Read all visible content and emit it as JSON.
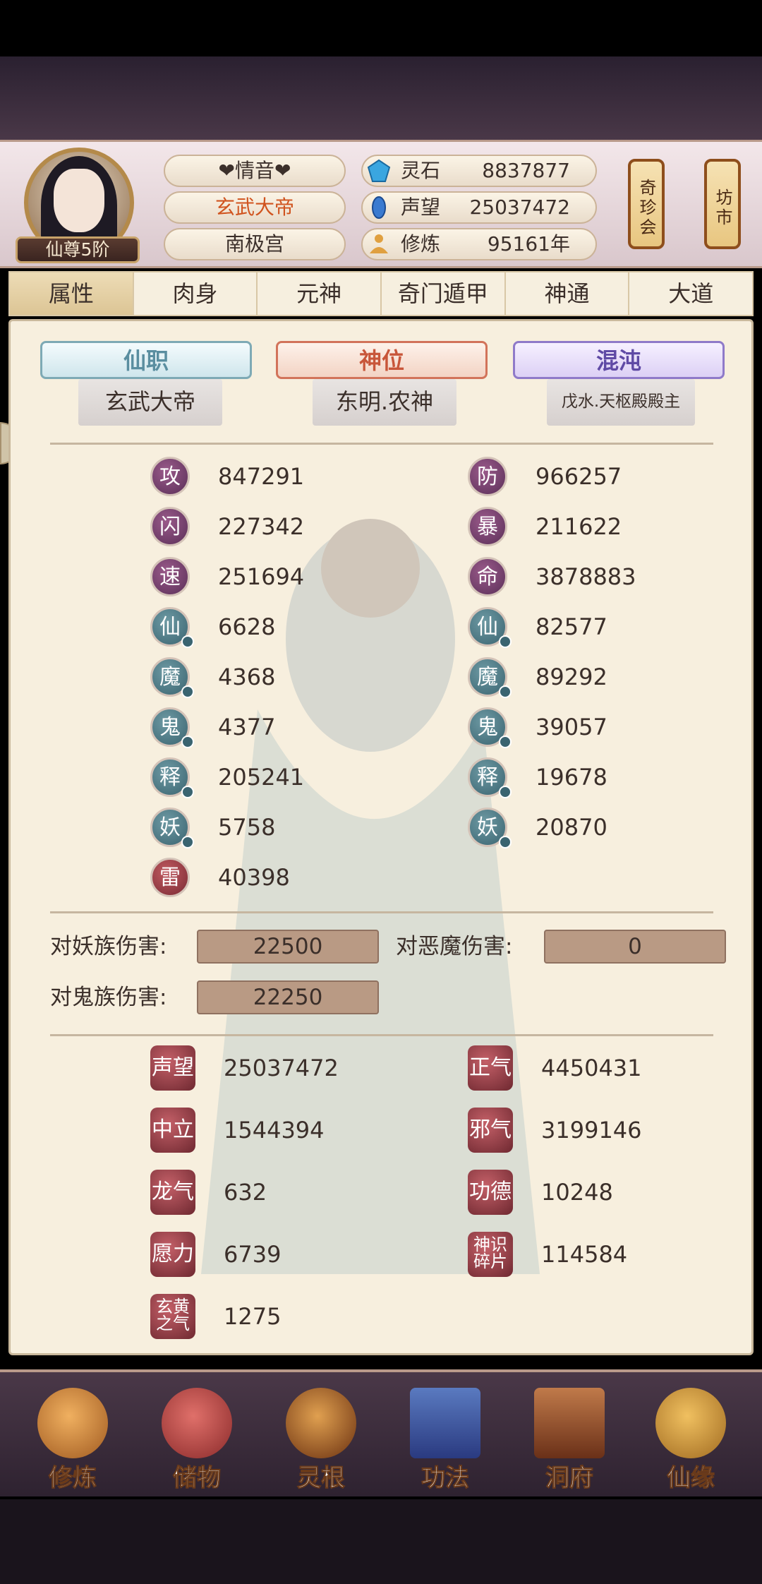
{
  "header": {
    "avatar_rank": "仙尊5阶",
    "name": "❤情音❤",
    "title": "玄武大帝",
    "palace": "南极宫",
    "resources": [
      {
        "icon": "spirit-stone-icon",
        "label": "灵石",
        "value": "8837877"
      },
      {
        "icon": "reputation-icon",
        "label": "声望",
        "value": "25037472"
      },
      {
        "icon": "meditate-icon",
        "label": "修炼",
        "value": "95161年"
      }
    ],
    "lanterns": [
      "奇珍会",
      "坊市"
    ]
  },
  "tabs": [
    "属性",
    "肉身",
    "元神",
    "奇门遁甲",
    "神通",
    "大道"
  ],
  "ranks": {
    "xianzhi": {
      "label": "仙职",
      "value": "玄武大帝"
    },
    "shenwei": {
      "label": "神位",
      "value": "东明.农神"
    },
    "hundun": {
      "label": "混沌",
      "value": "戊水.天枢殿殿主"
    }
  },
  "stats_left": [
    {
      "glyph": "攻",
      "value": "847291"
    },
    {
      "glyph": "闪",
      "value": "227342"
    },
    {
      "glyph": "速",
      "value": "251694"
    },
    {
      "glyph": "仙",
      "value": "6628"
    },
    {
      "glyph": "魔",
      "value": "4368"
    },
    {
      "glyph": "鬼",
      "value": "4377"
    },
    {
      "glyph": "释",
      "value": "205241"
    },
    {
      "glyph": "妖",
      "value": "5758"
    },
    {
      "glyph": "雷",
      "value": "40398"
    }
  ],
  "stats_right": [
    {
      "glyph": "防",
      "value": "966257"
    },
    {
      "glyph": "暴",
      "value": "211622"
    },
    {
      "glyph": "命",
      "value": "3878883"
    },
    {
      "glyph": "仙",
      "value": "82577"
    },
    {
      "glyph": "魔",
      "value": "89292"
    },
    {
      "glyph": "鬼",
      "value": "39057"
    },
    {
      "glyph": "释",
      "value": "19678"
    },
    {
      "glyph": "妖",
      "value": "20870"
    }
  ],
  "damage": [
    {
      "label": "对妖族伤害:",
      "value": "22500"
    },
    {
      "label": "对恶魔伤害:",
      "value": "0"
    },
    {
      "label": "对鬼族伤害:",
      "value": "22250"
    }
  ],
  "reputation_left": [
    {
      "key": "声望",
      "value": "25037472"
    },
    {
      "key": "中立",
      "value": "1544394"
    },
    {
      "key": "龙气",
      "value": "632"
    },
    {
      "key": "愿力",
      "value": "6739"
    },
    {
      "key": "玄黄之气",
      "value": "1275"
    }
  ],
  "reputation_right": [
    {
      "key": "正气",
      "value": "4450431"
    },
    {
      "key": "邪气",
      "value": "3199146"
    },
    {
      "key": "功德",
      "value": "10248"
    },
    {
      "key": "神识碎片",
      "value": "114584"
    }
  ],
  "bottom_nav": [
    {
      "label": "修炼",
      "icon": "cultivation-icon",
      "color": "#d88a3a"
    },
    {
      "label": "储物",
      "icon": "storage-bag-icon",
      "color": "#c2443a"
    },
    {
      "label": "灵根",
      "icon": "spirit-root-icon",
      "color": "#b06a2a"
    },
    {
      "label": "功法",
      "icon": "scripture-book-icon",
      "color": "#3a5aa0"
    },
    {
      "label": "洞府",
      "icon": "cave-mansion-icon",
      "color": "#8a4a2a"
    },
    {
      "label": "仙缘",
      "icon": "gourd-icon",
      "color": "#c28a3a"
    }
  ]
}
